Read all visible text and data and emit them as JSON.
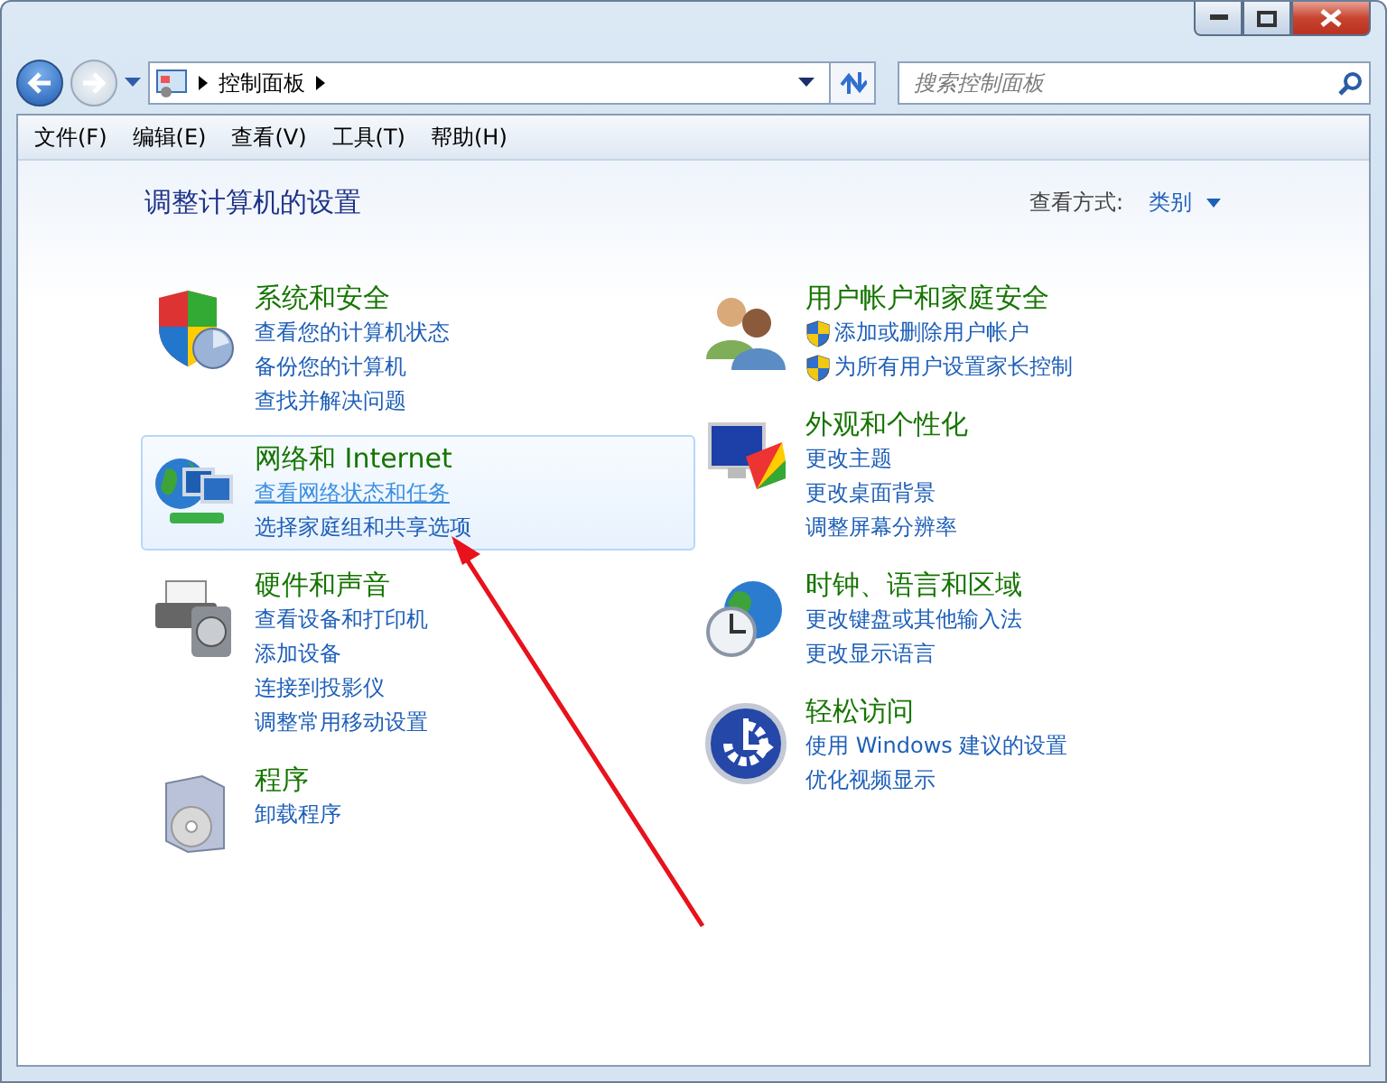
{
  "address_bar": {
    "crumbs": [
      "控制面板"
    ],
    "search": {
      "placeholder": "搜索控制面板"
    }
  },
  "menu": [
    "文件(F)",
    "编辑(E)",
    "查看(V)",
    "工具(T)",
    "帮助(H)"
  ],
  "heading": "调整计算机的设置",
  "view_by": {
    "label": "查看方式:",
    "value": "类别"
  },
  "columns": [
    [
      {
        "kind": "security",
        "title": "系统和安全",
        "highlighted": false,
        "links": [
          {
            "text": "查看您的计算机状态",
            "shield": false,
            "hovered": false
          },
          {
            "text": "备份您的计算机",
            "shield": false,
            "hovered": false
          },
          {
            "text": "查找并解决问题",
            "shield": false,
            "hovered": false
          }
        ]
      },
      {
        "kind": "network",
        "title": "网络和 Internet",
        "highlighted": true,
        "links": [
          {
            "text": "查看网络状态和任务",
            "shield": false,
            "hovered": true
          },
          {
            "text": "选择家庭组和共享选项",
            "shield": false,
            "hovered": false
          }
        ]
      },
      {
        "kind": "hardware",
        "title": "硬件和声音",
        "highlighted": false,
        "links": [
          {
            "text": "查看设备和打印机",
            "shield": false,
            "hovered": false
          },
          {
            "text": "添加设备",
            "shield": false,
            "hovered": false
          },
          {
            "text": "连接到投影仪",
            "shield": false,
            "hovered": false
          },
          {
            "text": "调整常用移动设置",
            "shield": false,
            "hovered": false
          }
        ]
      },
      {
        "kind": "programs",
        "title": "程序",
        "highlighted": false,
        "links": [
          {
            "text": "卸载程序",
            "shield": false,
            "hovered": false
          }
        ]
      }
    ],
    [
      {
        "kind": "users",
        "title": "用户帐户和家庭安全",
        "highlighted": false,
        "links": [
          {
            "text": "添加或删除用户帐户",
            "shield": true,
            "hovered": false
          },
          {
            "text": "为所有用户设置家长控制",
            "shield": true,
            "hovered": false
          }
        ]
      },
      {
        "kind": "appearance",
        "title": "外观和个性化",
        "highlighted": false,
        "links": [
          {
            "text": "更改主题",
            "shield": false,
            "hovered": false
          },
          {
            "text": "更改桌面背景",
            "shield": false,
            "hovered": false
          },
          {
            "text": "调整屏幕分辨率",
            "shield": false,
            "hovered": false
          }
        ]
      },
      {
        "kind": "clock",
        "title": "时钟、语言和区域",
        "highlighted": false,
        "links": [
          {
            "text": "更改键盘或其他输入法",
            "shield": false,
            "hovered": false
          },
          {
            "text": "更改显示语言",
            "shield": false,
            "hovered": false
          }
        ]
      },
      {
        "kind": "access",
        "title": "轻松访问",
        "highlighted": false,
        "links": [
          {
            "text": "使用 Windows 建议的设置",
            "shield": false,
            "hovered": false
          },
          {
            "text": "优化视频显示",
            "shield": false,
            "hovered": false
          }
        ]
      }
    ]
  ]
}
